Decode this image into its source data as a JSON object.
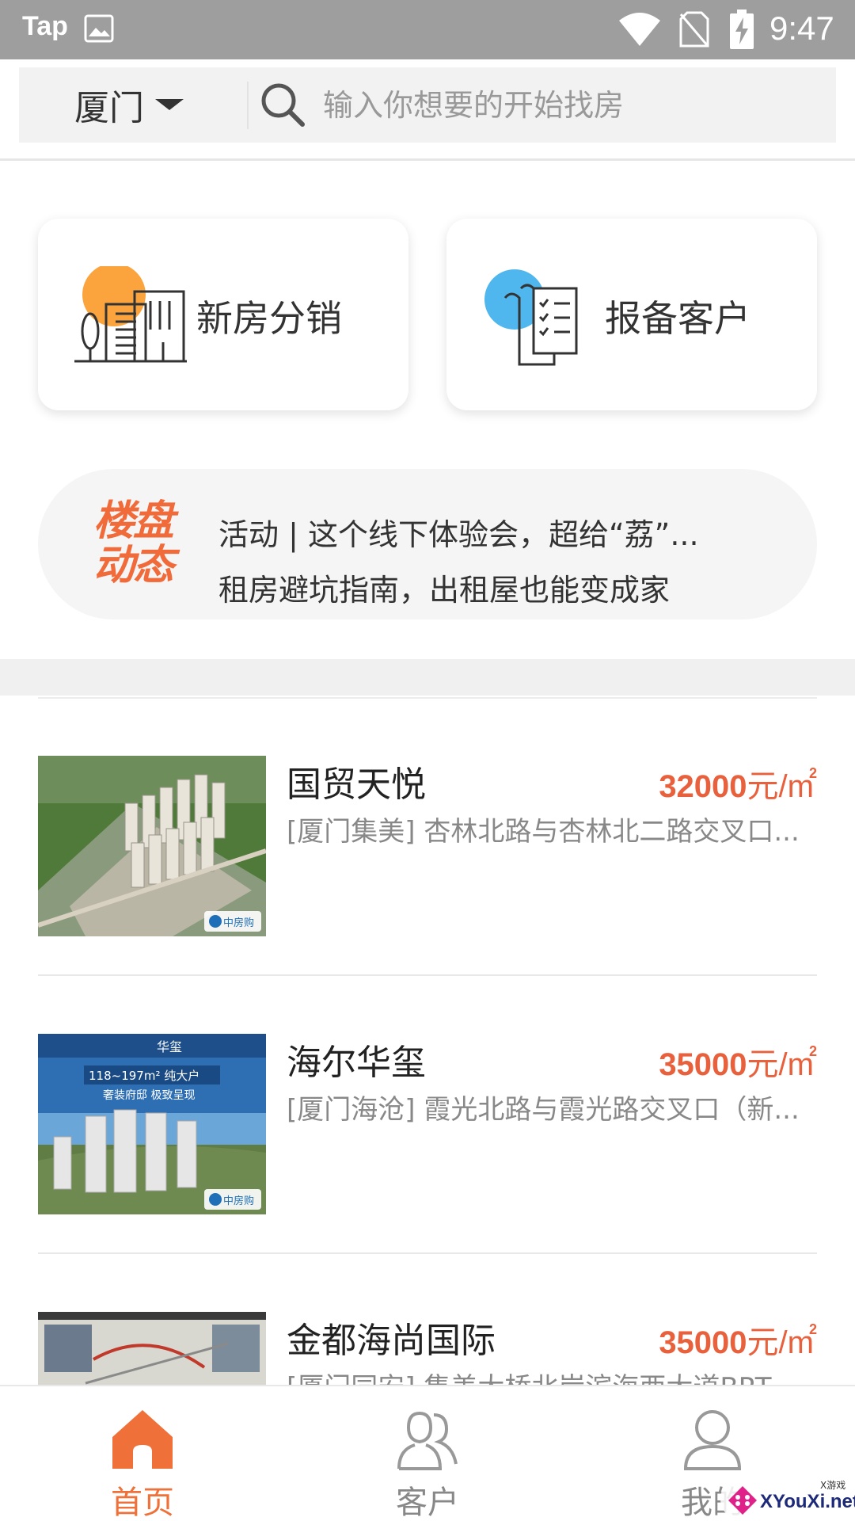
{
  "status_bar": {
    "app_label": "Tap",
    "time": "9:47"
  },
  "search": {
    "city": "厦门",
    "placeholder": "输入你想要的开始找房"
  },
  "actions": {
    "new_house": "新房分销",
    "report_client": "报备客户"
  },
  "news": {
    "logo_line1": "楼盘",
    "logo_line2": "动态",
    "items": [
      "活动 | 这个线下体验会，超给“荔”...",
      "租房避坑指南，出租屋也能变成家"
    ]
  },
  "listings": [
    {
      "name": "国贸天悦",
      "price": "32000",
      "unit": "元/m",
      "unit_sup": "2",
      "address": "[厦门集美] 杏林北路与杏林北二路交叉口..."
    },
    {
      "name": "海尔华玺",
      "price": "35000",
      "unit": "元/m",
      "unit_sup": "2",
      "address": "[厦门海沧] 霞光北路与霞光路交叉口（新...",
      "thumb_brand": "华玺",
      "thumb_line1": "118~197m² 纯大户",
      "thumb_line2": "奢装府邸  极致呈现"
    },
    {
      "name": "金都海尚国际",
      "price": "35000",
      "unit": "元/m",
      "unit_sup": "2",
      "address": "[厦门同安] 集美大桥北岸滨海西大道BRT..."
    }
  ],
  "thumb_badge": "中房购",
  "bottom_nav": {
    "home": "首页",
    "clients": "客户",
    "me": "我的"
  },
  "watermark": {
    "top": "X游戏",
    "text": "XYouXi.net"
  },
  "colors": {
    "accent": "#f0703a",
    "price": "#e8603c",
    "orange_dot": "#fba43e",
    "blue_dot": "#4fb6ee"
  }
}
